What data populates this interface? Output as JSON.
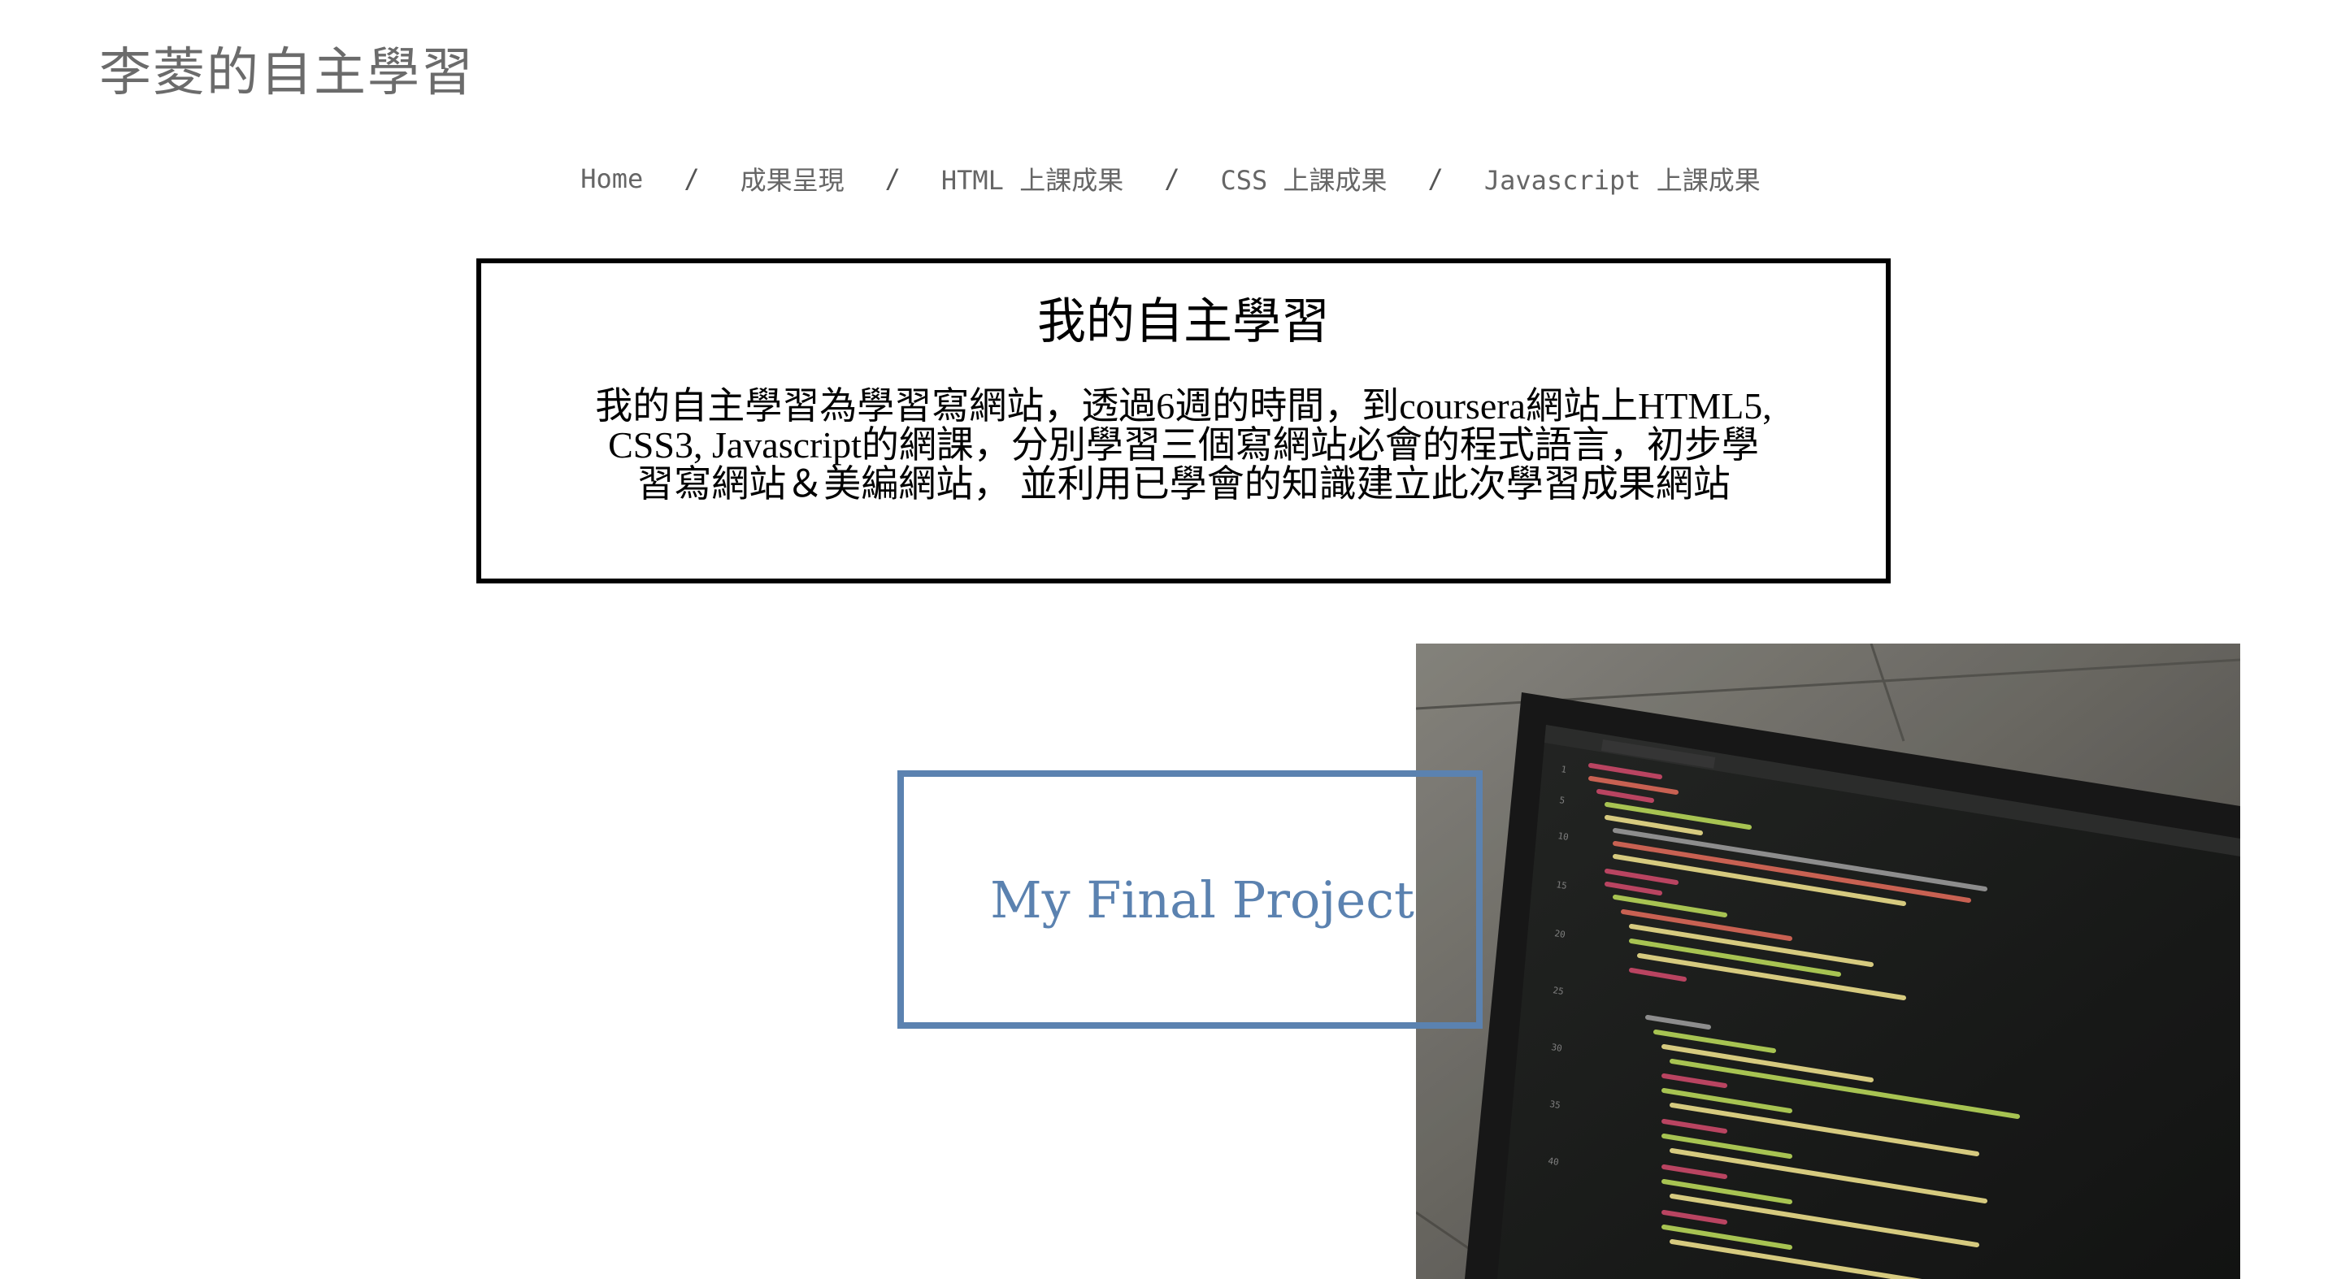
{
  "site": {
    "title": "李菱的自主學習"
  },
  "nav": {
    "items": [
      {
        "label": "Home"
      },
      {
        "label": "成果呈現"
      },
      {
        "label": "HTML 上課成果"
      },
      {
        "label": "CSS 上課成果"
      },
      {
        "label": "Javascript 上課成果"
      }
    ],
    "separator": "/"
  },
  "intro": {
    "heading": "我的自主學習",
    "body": "我的自主學習為學習寫網站，透過6週的時間，到coursera網站上HTML5, CSS3, Javascript的網課，分別學習三個寫網站必會的程式語言，初步學習寫網站＆美編網站， 並利用已學會的知識建立此次學習成果網站"
  },
  "hero": {
    "project_title": "My Final Project",
    "image": "laptop-code-photo",
    "accent_color": "#5b82b0"
  }
}
